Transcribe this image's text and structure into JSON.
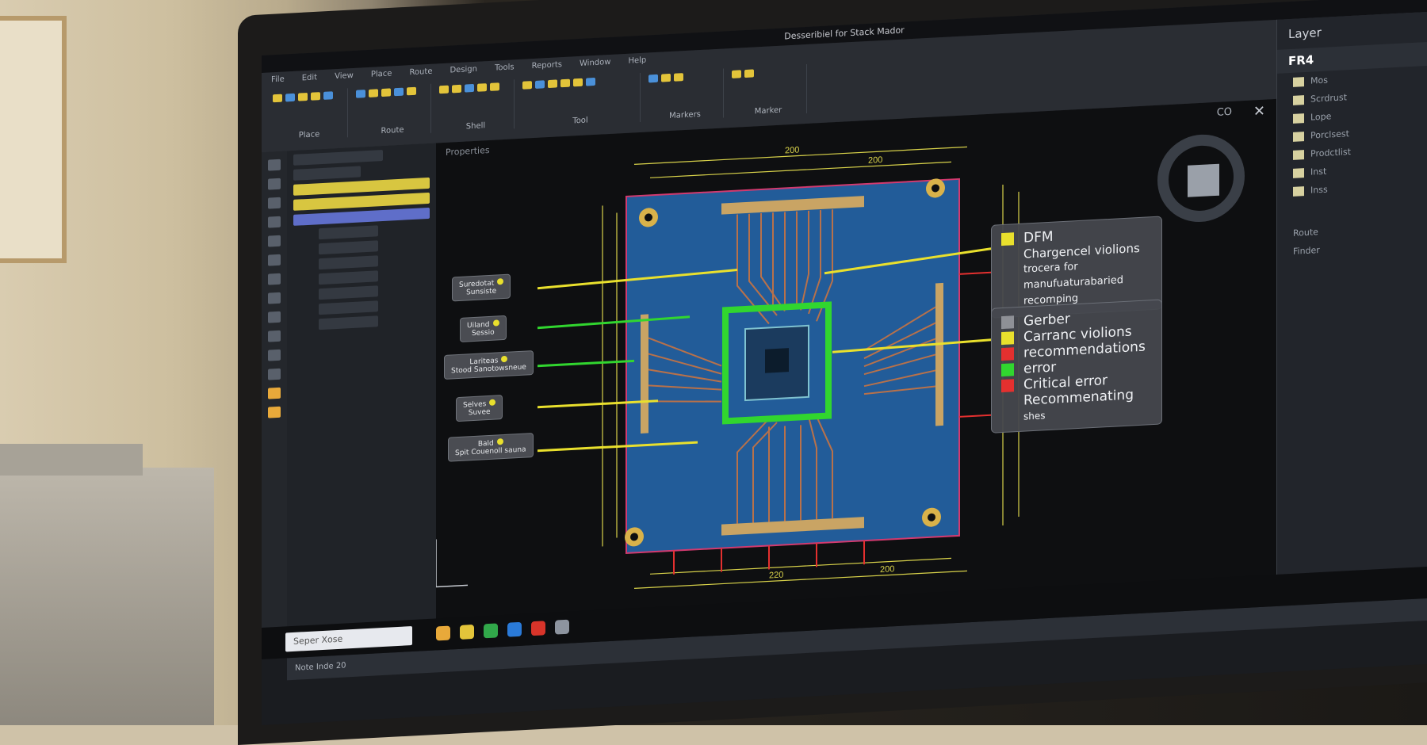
{
  "app": {
    "title": "Desseribiel for Stack Mador"
  },
  "colors": {
    "yellow": "#e9e02d",
    "green": "#31d62f",
    "red": "#e4302f",
    "gray": "#8e9096",
    "board": "#225c99",
    "copper": "#b8714a"
  },
  "menu": [
    "File",
    "Edit",
    "View",
    "Place",
    "Route",
    "Design",
    "Tools",
    "Reports",
    "Window",
    "Help"
  ],
  "ribbon_groups": [
    {
      "label": "Place"
    },
    {
      "label": "Route"
    },
    {
      "label": "Shell"
    },
    {
      "label": "Tool"
    },
    {
      "label": "Markers"
    },
    {
      "label": "Marker"
    }
  ],
  "canvas": {
    "title": "Properties",
    "co_label": "CO",
    "close_icon": "✕"
  },
  "right_panel": {
    "title": "Layer",
    "header": "FR4",
    "items": [
      "Mos",
      "Scrdrust",
      "Lope",
      "Porclsest",
      "Prodctlist",
      "Inst",
      "Inss"
    ],
    "sub_items": [
      "Route",
      "Finder"
    ]
  },
  "dims": {
    "top_a": "200",
    "top_b": "200",
    "bottom_a": "220",
    "bottom_b": "200"
  },
  "left_labels": [
    {
      "title": "Suredotat",
      "sub": "Sunsiste"
    },
    {
      "title": "Uiland",
      "sub": "Sessio"
    },
    {
      "title": "Lariteas",
      "sub": "Stood Sanotowsneue"
    },
    {
      "title": "Selves",
      "sub": "Suvee"
    },
    {
      "title": "Bald",
      "sub": "Spit Couenoll sauna"
    }
  ],
  "dfm_callout": {
    "title": "DFM",
    "lines": [
      "Chargencel violions",
      "trocera for",
      "manufuaturabaried",
      "recomping"
    ]
  },
  "legend_callout": {
    "items": [
      {
        "text": "Gerber",
        "color": "#8e9096"
      },
      {
        "text": "Carranc violions",
        "color": "#e9e02d"
      },
      {
        "text": "recommendations",
        "color": "#e4302f"
      },
      {
        "text": "error",
        "color": "#31d62f"
      },
      {
        "text": "Critical error",
        "color": "#e4302f"
      },
      {
        "text": "Recommenating",
        "color": ""
      },
      {
        "text": "shes",
        "color": ""
      }
    ]
  },
  "timeline": {
    "text": "Note Inde 20"
  },
  "taskbar": {
    "search_placeholder": "Seper Xose"
  }
}
